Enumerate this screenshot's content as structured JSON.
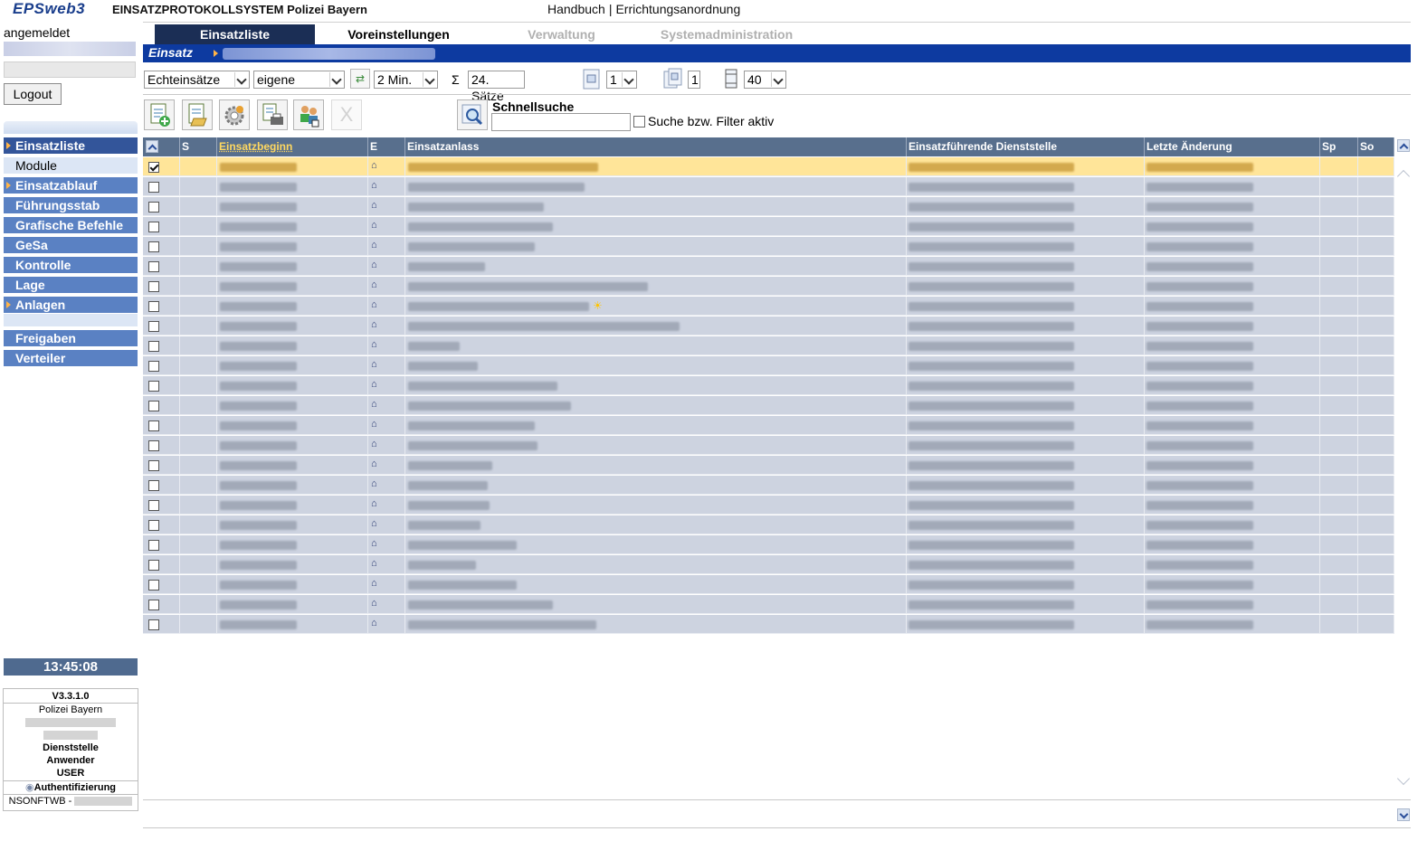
{
  "app": {
    "logo": "EPSweb3",
    "system_name": "EINSATZPROTOKOLLSYSTEM Polizei Bayern",
    "links": [
      "Handbuch",
      "Errichtungsanordnung"
    ],
    "link_separator": "|"
  },
  "sidebar": {
    "login_status": "angemeldet",
    "logout_label": "Logout",
    "nav_items": [
      {
        "label": "Einsatzliste",
        "active": true
      },
      {
        "label": "Module",
        "sub": true
      },
      {
        "label": "Einsatzablauf"
      },
      {
        "label": "Führungsstab"
      },
      {
        "label": "Grafische Befehle"
      },
      {
        "label": "GeSa"
      },
      {
        "label": "Kontrolle"
      },
      {
        "label": "Lage"
      },
      {
        "label": "Anlagen"
      },
      {
        "label": "Freigaben"
      },
      {
        "label": "Verteiler"
      }
    ],
    "clock": "13:45:08",
    "info": {
      "version": "V3.3.1.0",
      "org": "Polizei Bayern",
      "dienststelle": "Dienststelle",
      "anwender": "Anwender",
      "role": "USER",
      "auth": "Authentifizierung",
      "ns": "NSONFTWB -"
    }
  },
  "tabs": [
    {
      "label": "Einsatzliste",
      "state": "active"
    },
    {
      "label": "Voreinstellungen",
      "state": "enabled"
    },
    {
      "label": "Verwaltung",
      "state": "disabled"
    },
    {
      "label": "Systemadministration",
      "state": "disabled"
    }
  ],
  "breadcrumb": {
    "label": "Einsatz"
  },
  "controls": {
    "type_select": "Echteinsätze",
    "scope_select": "eigene",
    "refresh_interval": "2 Min.",
    "sum_symbol": "Σ",
    "records": "24. Sätze",
    "page_select": "1",
    "page_count": "1",
    "rows_per_page": "40"
  },
  "toolbar": {
    "quicksearch_label": "Schnellsuche",
    "quicksearch_value": "",
    "filter_label": "Suche bzw. Filter aktiv",
    "filter_active": false,
    "disabled_label": "X"
  },
  "table": {
    "columns": [
      "S",
      "Einsatzbeginn",
      "E",
      "Einsatzanlass",
      "Einsatzführende Dienststelle",
      "Letzte Änderung",
      "Sp",
      "So"
    ],
    "sorted_column": "Einsatzbeginn",
    "row_count": 24,
    "selected_row": 0,
    "anlass_lengths": [
      210,
      195,
      150,
      160,
      140,
      85,
      265,
      200,
      300,
      57,
      77,
      165,
      180,
      140,
      143,
      93,
      88,
      90,
      80,
      120,
      75,
      120,
      160,
      208
    ],
    "star_row": 7
  },
  "colors": {
    "accent_dark": "#1b2e55",
    "breadcrumb_blue": "#0d3aa0",
    "nav_blue": "#5a81c3",
    "header_gray": "#586f8d",
    "row_bg": "#cdd3e0",
    "selected_row_bg": "#ffe599"
  }
}
